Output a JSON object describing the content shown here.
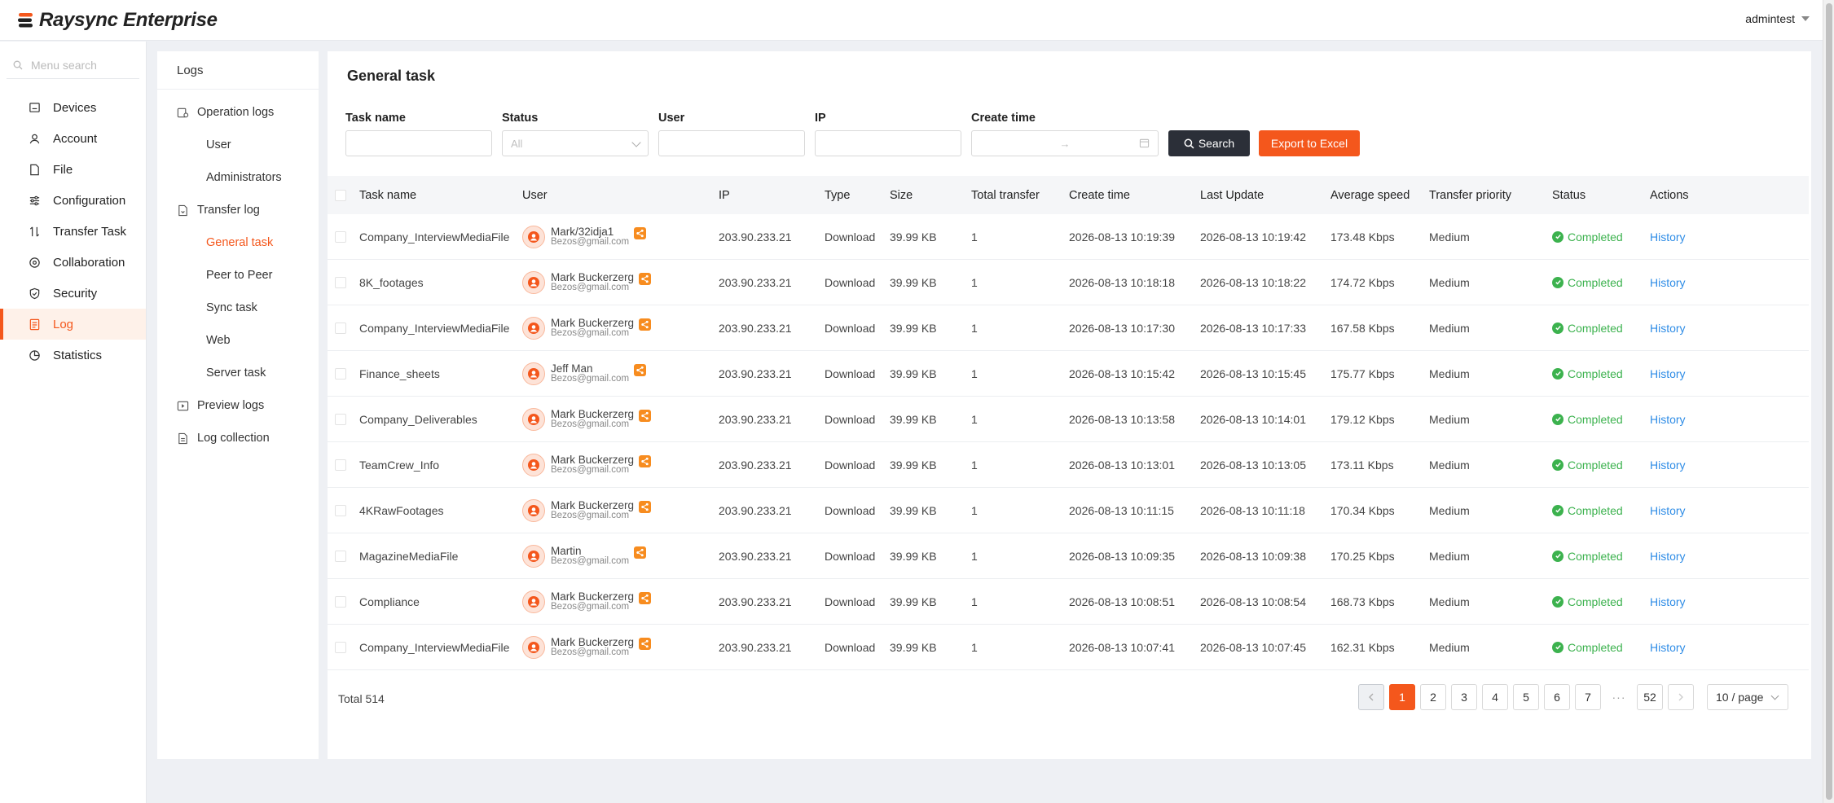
{
  "app": {
    "name": "Raysync Enterprise",
    "user": "admintest"
  },
  "sidebar": {
    "search_placeholder": "Menu search",
    "items": [
      {
        "label": "Devices",
        "icon": "monitor-icon"
      },
      {
        "label": "Account",
        "icon": "user-icon"
      },
      {
        "label": "File",
        "icon": "file-icon"
      },
      {
        "label": "Configuration",
        "icon": "sliders-icon"
      },
      {
        "label": "Transfer Task",
        "icon": "transfer-icon"
      },
      {
        "label": "Collaboration",
        "icon": "collaboration-icon"
      },
      {
        "label": "Security",
        "icon": "shield-icon"
      },
      {
        "label": "Log",
        "icon": "log-icon"
      },
      {
        "label": "Statistics",
        "icon": "chart-icon"
      }
    ],
    "active": "Log"
  },
  "logs_panel": {
    "title": "Logs",
    "groups": [
      {
        "label": "Operation logs",
        "children": [
          "User",
          "Administrators"
        ]
      },
      {
        "label": "Transfer log",
        "children": [
          "General task",
          "Peer to Peer",
          "Sync task",
          "Web",
          "Server task"
        ]
      },
      {
        "label": "Preview logs",
        "children": []
      },
      {
        "label": "Log collection",
        "children": []
      }
    ],
    "active": "General task"
  },
  "main": {
    "title": "General task",
    "filters": {
      "task_name_label": "Task name",
      "status_label": "Status",
      "status_value": "All",
      "user_label": "User",
      "ip_label": "IP",
      "create_time_label": "Create time",
      "date_separator": "→",
      "search_label": "Search",
      "export_label": "Export to Excel"
    },
    "columns": [
      "Task name",
      "User",
      "IP",
      "Type",
      "Size",
      "Total transfer",
      "Create time",
      "Last Update",
      "Average speed",
      "Transfer priority",
      "Status",
      "Actions"
    ],
    "rows": [
      {
        "task": "Company_InterviewMediaFile",
        "user": "Mark/32idja1",
        "email": "Bezos@gmail.com",
        "ip": "203.90.233.21",
        "type": "Download",
        "size": "39.99 KB",
        "total": "1",
        "created": "2026-08-13 10:19:39",
        "updated": "2026-08-13 10:19:42",
        "speed": "173.48 Kbps",
        "priority": "Medium",
        "status": "Completed",
        "action": "History"
      },
      {
        "task": "8K_footages",
        "user": "Mark Buckerzerg",
        "email": "Bezos@gmail.com",
        "ip": "203.90.233.21",
        "type": "Download",
        "size": "39.99 KB",
        "total": "1",
        "created": "2026-08-13 10:18:18",
        "updated": "2026-08-13 10:18:22",
        "speed": "174.72 Kbps",
        "priority": "Medium",
        "status": "Completed",
        "action": "History"
      },
      {
        "task": "Company_InterviewMediaFile",
        "user": "Mark Buckerzerg",
        "email": "Bezos@gmail.com",
        "ip": "203.90.233.21",
        "type": "Download",
        "size": "39.99 KB",
        "total": "1",
        "created": "2026-08-13 10:17:30",
        "updated": "2026-08-13 10:17:33",
        "speed": "167.58 Kbps",
        "priority": "Medium",
        "status": "Completed",
        "action": "History"
      },
      {
        "task": "Finance_sheets",
        "user": "Jeff Man",
        "email": "Bezos@gmail.com",
        "ip": "203.90.233.21",
        "type": "Download",
        "size": "39.99 KB",
        "total": "1",
        "created": "2026-08-13 10:15:42",
        "updated": "2026-08-13 10:15:45",
        "speed": "175.77 Kbps",
        "priority": "Medium",
        "status": "Completed",
        "action": "History"
      },
      {
        "task": "Company_Deliverables",
        "user": "Mark Buckerzerg",
        "email": "Bezos@gmail.com",
        "ip": "203.90.233.21",
        "type": "Download",
        "size": "39.99 KB",
        "total": "1",
        "created": "2026-08-13 10:13:58",
        "updated": "2026-08-13 10:14:01",
        "speed": "179.12 Kbps",
        "priority": "Medium",
        "status": "Completed",
        "action": "History"
      },
      {
        "task": "TeamCrew_Info",
        "user": "Mark Buckerzerg",
        "email": "Bezos@gmail.com",
        "ip": "203.90.233.21",
        "type": "Download",
        "size": "39.99 KB",
        "total": "1",
        "created": "2026-08-13 10:13:01",
        "updated": "2026-08-13 10:13:05",
        "speed": "173.11 Kbps",
        "priority": "Medium",
        "status": "Completed",
        "action": "History"
      },
      {
        "task": "4KRawFootages",
        "user": "Mark Buckerzerg",
        "email": "Bezos@gmail.com",
        "ip": "203.90.233.21",
        "type": "Download",
        "size": "39.99 KB",
        "total": "1",
        "created": "2026-08-13 10:11:15",
        "updated": "2026-08-13 10:11:18",
        "speed": "170.34 Kbps",
        "priority": "Medium",
        "status": "Completed",
        "action": "History"
      },
      {
        "task": "MagazineMediaFile",
        "user": "Martin",
        "email": "Bezos@gmail.com",
        "ip": "203.90.233.21",
        "type": "Download",
        "size": "39.99 KB",
        "total": "1",
        "created": "2026-08-13 10:09:35",
        "updated": "2026-08-13 10:09:38",
        "speed": "170.25 Kbps",
        "priority": "Medium",
        "status": "Completed",
        "action": "History"
      },
      {
        "task": "Compliance",
        "user": "Mark Buckerzerg",
        "email": "Bezos@gmail.com",
        "ip": "203.90.233.21",
        "type": "Download",
        "size": "39.99 KB",
        "total": "1",
        "created": "2026-08-13 10:08:51",
        "updated": "2026-08-13 10:08:54",
        "speed": "168.73 Kbps",
        "priority": "Medium",
        "status": "Completed",
        "action": "History"
      },
      {
        "task": "Company_InterviewMediaFile",
        "user": "Mark Buckerzerg",
        "email": "Bezos@gmail.com",
        "ip": "203.90.233.21",
        "type": "Download",
        "size": "39.99 KB",
        "total": "1",
        "created": "2026-08-13 10:07:41",
        "updated": "2026-08-13 10:07:45",
        "speed": "162.31 Kbps",
        "priority": "Medium",
        "status": "Completed",
        "action": "History"
      }
    ],
    "pagination": {
      "total_text": "Total 514",
      "pages": [
        "1",
        "2",
        "3",
        "4",
        "5",
        "6",
        "7"
      ],
      "ellipsis": "···",
      "last_page": "52",
      "current": "1",
      "page_size": "10 / page"
    }
  },
  "colors": {
    "accent": "#f4571c",
    "success": "#3cb24e",
    "link": "#2e8ce6",
    "dark_button": "#2b2f38"
  }
}
